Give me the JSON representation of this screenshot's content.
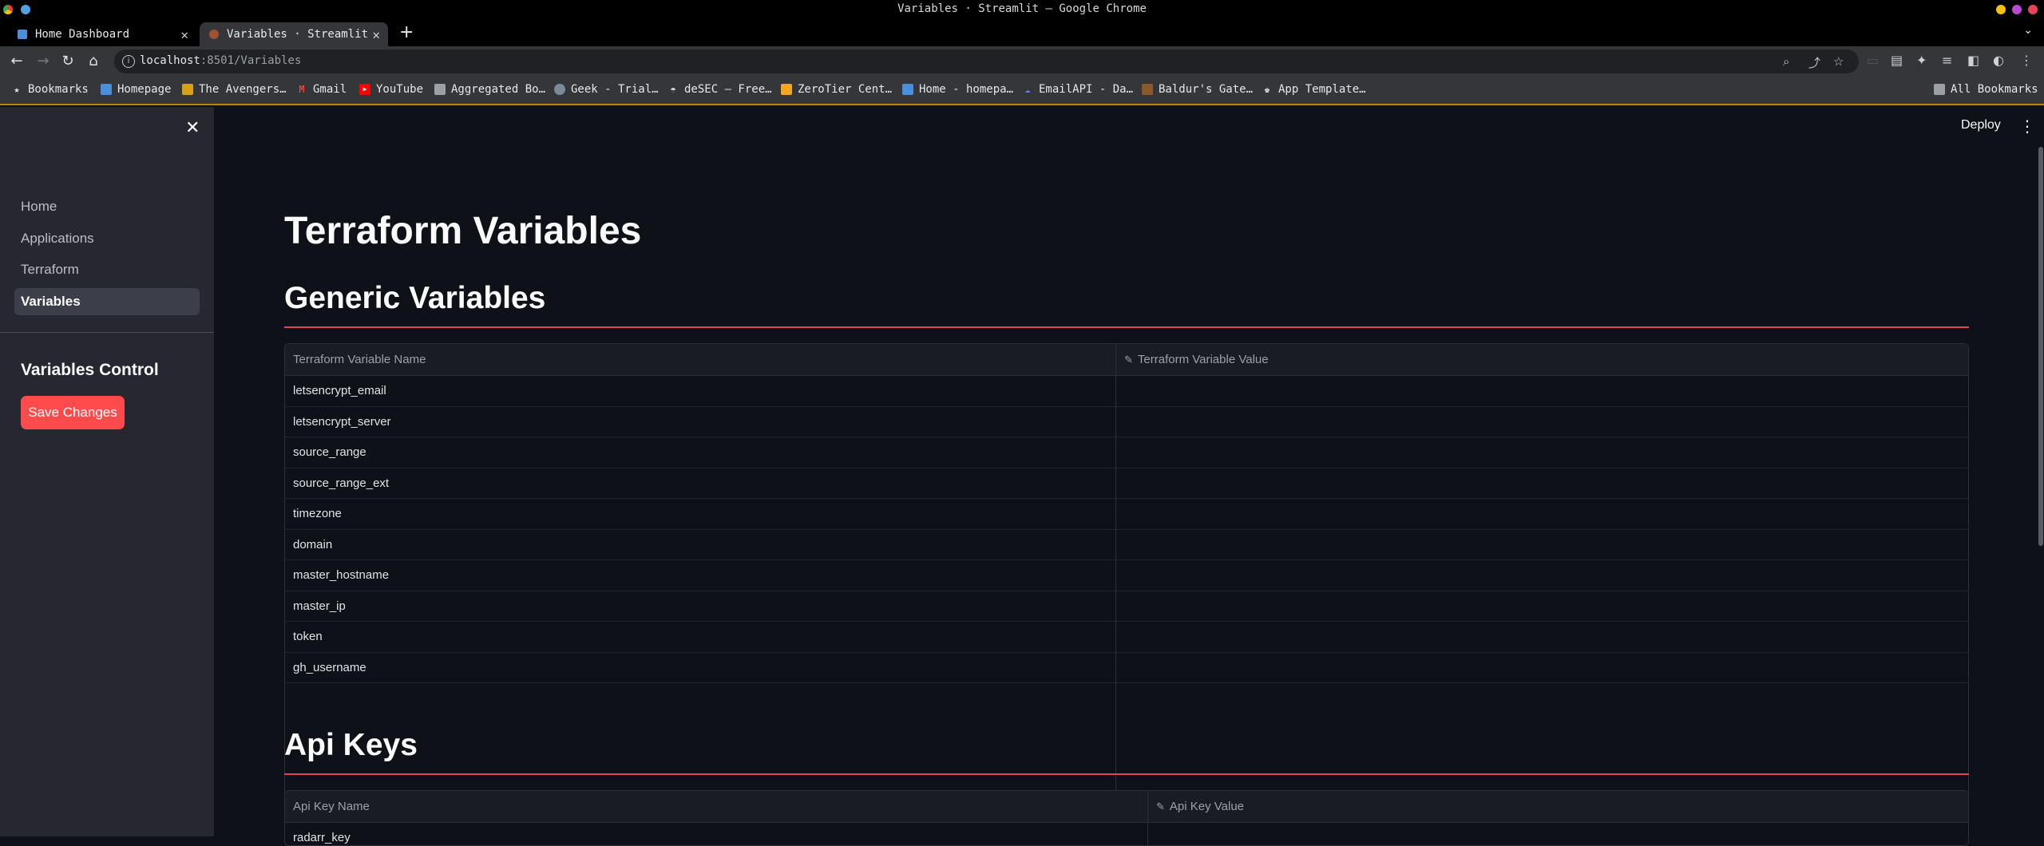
{
  "window": {
    "title": "Variables · Streamlit — Google Chrome"
  },
  "tabs": [
    {
      "label": "Home Dashboard",
      "active": false,
      "favicon_color": "#4a90d9"
    },
    {
      "label": "Variables · Streamlit",
      "active": true,
      "favicon_color": "#a0522d"
    }
  ],
  "address": {
    "host": "localhost",
    "path": ":8501/Variables"
  },
  "bookmarks": [
    {
      "label": "Bookmarks",
      "icon": "star-icon"
    },
    {
      "label": "Homepage",
      "icon": "flag-icon"
    },
    {
      "label": "The Avengers…",
      "icon": "site-icon"
    },
    {
      "label": "Gmail",
      "icon": "gmail-icon"
    },
    {
      "label": "YouTube",
      "icon": "youtube-icon"
    },
    {
      "label": "Aggregated Bo…",
      "icon": "folder-icon"
    },
    {
      "label": "Geek - Trial…",
      "icon": "site-icon"
    },
    {
      "label": "deSEC – Free…",
      "icon": "umbrella-icon"
    },
    {
      "label": "ZeroTier Cent…",
      "icon": "site-icon"
    },
    {
      "label": "Home - homepa…",
      "icon": "flag-icon"
    },
    {
      "label": "EmailAPI - Da…",
      "icon": "site-icon"
    },
    {
      "label": "Baldur's Gate…",
      "icon": "site-icon"
    },
    {
      "label": "App Template…",
      "icon": "site-icon"
    },
    {
      "label": "All Bookmarks",
      "icon": "folder-icon"
    }
  ],
  "app": {
    "deploy_label": "Deploy",
    "sidebar": {
      "nav": [
        {
          "label": "Home",
          "active": false
        },
        {
          "label": "Applications",
          "active": false
        },
        {
          "label": "Terraform",
          "active": false
        },
        {
          "label": "Variables",
          "active": true
        }
      ],
      "control_title": "Variables Control",
      "save_label": "Save Changes"
    },
    "page_title": "Terraform Variables",
    "generic": {
      "heading": "Generic Variables",
      "col_name": "Terraform Variable Name",
      "col_value": "Terraform Variable Value",
      "rows": [
        "letsencrypt_email",
        "letsencrypt_server",
        "source_range",
        "source_range_ext",
        "timezone",
        "domain",
        "master_hostname",
        "master_ip",
        "token",
        "gh_username"
      ]
    },
    "apikeys": {
      "heading": "Api Keys",
      "col_name": "Api Key Name",
      "col_value": "Api Key Value",
      "rows": [
        "radarr_key"
      ]
    }
  },
  "colors": {
    "accent": "#ff4b4b",
    "background": "#0e1117",
    "sidebar": "#262730"
  }
}
